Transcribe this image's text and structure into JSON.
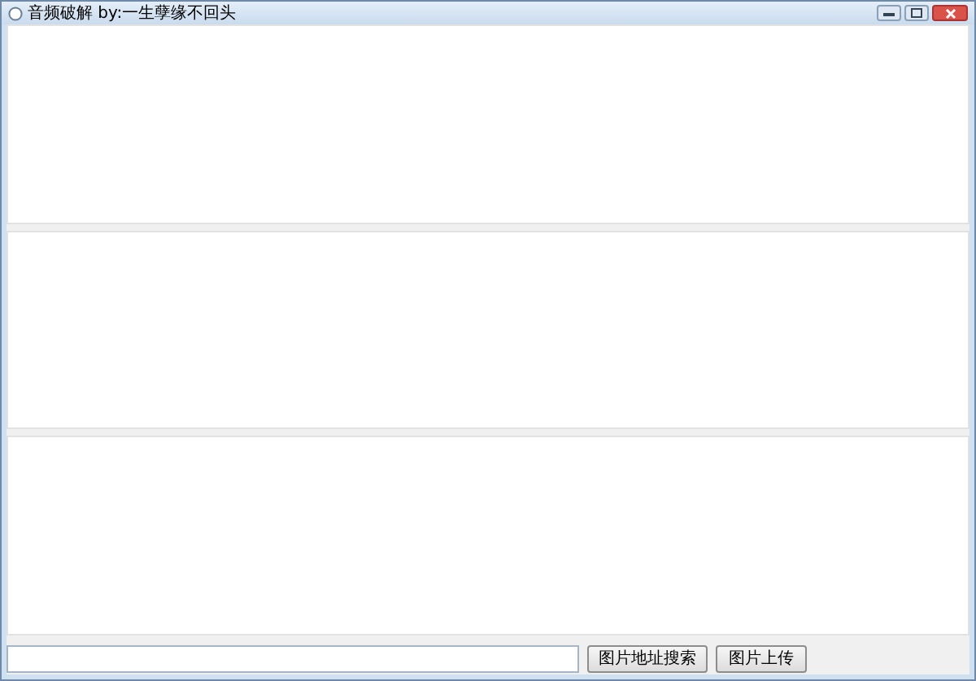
{
  "window": {
    "title": "音频破解 by:一生孽缘不回头"
  },
  "panes": [
    {
      "kind": "text-area"
    },
    {
      "kind": "text-area"
    },
    {
      "kind": "text-area"
    }
  ],
  "buttons": [
    {
      "label": "图片地址搜索"
    },
    {
      "label": "图片上传"
    }
  ]
}
